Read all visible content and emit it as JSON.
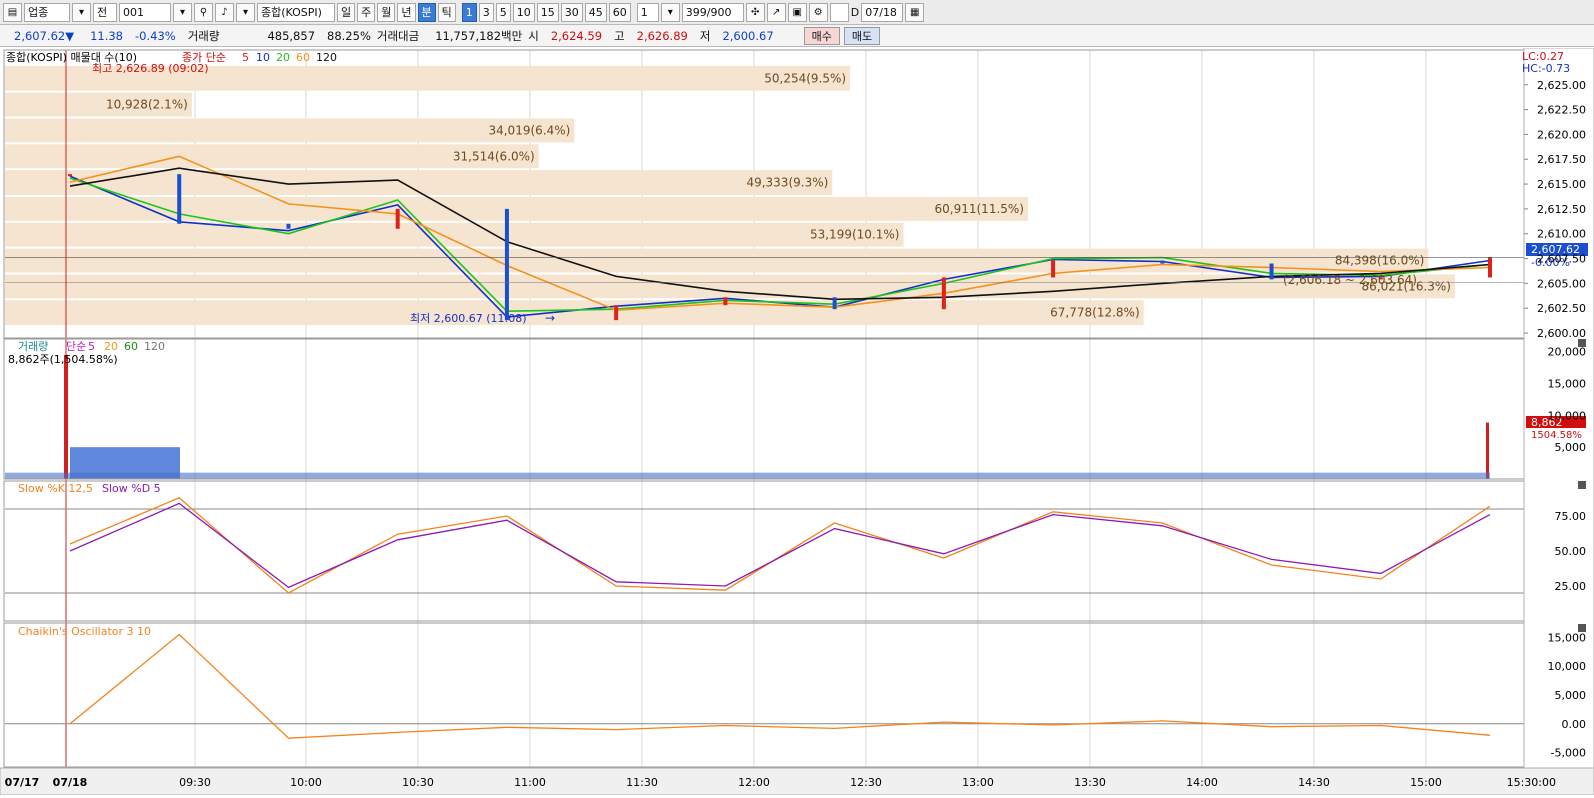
{
  "toolbar": {
    "market": "업종",
    "scope": "전",
    "code": "001",
    "name": "종합(KOSPI)",
    "periods": [
      "일",
      "주",
      "월",
      "년"
    ],
    "minute": "분",
    "tick": "틱",
    "intervals": [
      "1",
      "3",
      "5",
      "10",
      "15",
      "30",
      "45",
      "60"
    ],
    "active_interval": "1",
    "unit": "1",
    "count": "399",
    "count_max": "/900",
    "date_flag": "D",
    "date": "07/18"
  },
  "quote": {
    "price": "2,607.62",
    "change_sign": "▼",
    "change": "11.38",
    "change_pct": "-0.43%",
    "volume_label": "거래량",
    "volume": "485,857",
    "volume_ratio": "88.25%",
    "amount_label": "거래대금",
    "amount": "11,757,182백만",
    "open_label": "시",
    "open": "2,624.59",
    "high_label": "고",
    "high": "2,626.89",
    "low_label": "저",
    "low": "2,600.67",
    "buy": "매수",
    "sell": "매도"
  },
  "price_pane": {
    "title": "종합(KOSPI) 매물대 수(10)",
    "ma_label": "종가 단순",
    "ma_periods": [
      "5",
      "10",
      "20",
      "60",
      "120"
    ],
    "ma_colors": [
      "#e0201a",
      "#1530c8",
      "#1bc41b",
      "#f5921e",
      "#111111"
    ],
    "high_annotation": "최고 2,626.89 (09:02)",
    "low_annotation": "최저 2,600.67 (11:08)",
    "lc": "LC:0.27",
    "hc": "HC:-0.73",
    "last_price": "2,607.62",
    "last_change": "-0.00%",
    "range_annotation": "(2,606.18 ~ 2,603.64)",
    "y_ticks": [
      "2,625.00",
      "2,622.50",
      "2,620.00",
      "2,617.50",
      "2,615.00",
      "2,612.50",
      "2,610.00",
      "2,607.50",
      "2,605.00",
      "2,602.50",
      "2,600.00"
    ],
    "volume_profile": [
      {
        "label": "50,254(9.5%)",
        "lo": 2624.3,
        "hi": 2627.0
      },
      {
        "label": "10,928(2.1%)",
        "lo": 2621.7,
        "hi": 2624.3
      },
      {
        "label": "34,019(6.4%)",
        "lo": 2619.1,
        "hi": 2621.7
      },
      {
        "label": "31,514(6.0%)",
        "lo": 2616.5,
        "hi": 2619.1
      },
      {
        "label": "49,333(9.3%)",
        "lo": 2613.8,
        "hi": 2616.5
      },
      {
        "label": "60,911(11.5%)",
        "lo": 2611.2,
        "hi": 2613.8
      },
      {
        "label": "53,199(10.1%)",
        "lo": 2608.6,
        "hi": 2611.2
      },
      {
        "label": "84,398(16.0%)",
        "lo": 2606.0,
        "hi": 2608.6
      },
      {
        "label": "86,021(16.3%)",
        "lo": 2603.4,
        "hi": 2606.0
      },
      {
        "label": "67,778(12.8%)",
        "lo": 2600.7,
        "hi": 2603.4
      }
    ]
  },
  "volume_pane": {
    "title": "거래량",
    "ma_label": "단순",
    "ma_periods": [
      "5",
      "20",
      "60",
      "120"
    ],
    "info": "8,862주(1,504.58%)",
    "last_value": "8,862",
    "last_ratio": "1504.58%",
    "y_ticks": [
      "20,000",
      "15,000",
      "10,000",
      "5,000"
    ]
  },
  "stoch_pane": {
    "title_k": "Slow %K 12,5",
    "title_d": "Slow %D 5",
    "y_ticks": [
      "75.00",
      "50.00",
      "25.00"
    ]
  },
  "chaikin_pane": {
    "title": "Chaikin's Oscillator 3 10",
    "y_ticks": [
      "15,000",
      "10,000",
      "5,000",
      "0.00",
      "-5,000"
    ]
  },
  "time_axis": [
    "07/17",
    "07/18",
    "09:30",
    "10:00",
    "10:30",
    "11:00",
    "11:30",
    "12:00",
    "12:30",
    "13:00",
    "13:30",
    "14:00",
    "14:30",
    "15:00",
    "15:30:00"
  ],
  "chart_data": {
    "type": "line",
    "title": "종합(KOSPI)",
    "x": [
      "09:00",
      "09:30",
      "10:00",
      "10:30",
      "11:00",
      "11:30",
      "12:00",
      "12:30",
      "13:00",
      "13:30",
      "14:00",
      "14:30",
      "15:00",
      "15:20"
    ],
    "series": [
      {
        "name": "종가",
        "values": [
          2616.0,
          2611.0,
          2610.5,
          2612.5,
          2601.3,
          2602.8,
          2603.6,
          2602.4,
          2605.6,
          2607.3,
          2607.0,
          2605.4,
          2605.6,
          2607.62
        ]
      },
      {
        "name": "5",
        "values": [
          2615.8,
          2611.2,
          2610.3,
          2612.9,
          2601.6,
          2602.7,
          2603.5,
          2602.6,
          2605.4,
          2607.4,
          2607.2,
          2605.6,
          2605.7,
          2607.3
        ]
      },
      {
        "name": "20",
        "values": [
          2615.6,
          2612.0,
          2610.0,
          2613.4,
          2602.2,
          2602.4,
          2603.3,
          2602.9,
          2605.0,
          2607.5,
          2607.6,
          2606.0,
          2605.8,
          2606.9
        ]
      },
      {
        "name": "60",
        "values": [
          2615.2,
          2617.8,
          2613.0,
          2612.0,
          2606.8,
          2602.3,
          2603.0,
          2602.6,
          2604.0,
          2606.0,
          2606.9,
          2606.6,
          2606.2,
          2606.6
        ]
      },
      {
        "name": "120",
        "values": [
          2614.8,
          2616.6,
          2615.0,
          2615.4,
          2609.2,
          2605.7,
          2604.2,
          2603.4,
          2603.6,
          2604.2,
          2605.0,
          2605.7,
          2606.0,
          2606.9
        ]
      }
    ],
    "ylim": [
      2599.5,
      2628.5
    ],
    "volume": {
      "spike_0900": 19500,
      "spike_close": 8862,
      "typical": 1000
    },
    "stochastic": {
      "k": [
        55,
        88,
        20,
        62,
        75,
        25,
        22,
        70,
        45,
        78,
        70,
        40,
        30,
        82
      ],
      "d": [
        50,
        84,
        24,
        58,
        72,
        28,
        25,
        66,
        48,
        76,
        68,
        44,
        34,
        76
      ]
    },
    "chaikin": {
      "values": [
        0,
        15500,
        -2500,
        -1500,
        -600,
        -1000,
        -300,
        -800,
        300,
        -200,
        500,
        -500,
        -300,
        -2000
      ]
    }
  }
}
